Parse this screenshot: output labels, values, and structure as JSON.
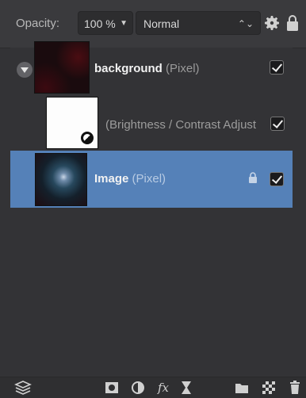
{
  "toolbar": {
    "opacity_label": "Opacity:",
    "opacity_value": "100 %",
    "blend_mode": "Normal"
  },
  "layers": [
    {
      "name": "background",
      "type": "(Pixel)",
      "visible": true,
      "thumbnail": "dark-red-texture"
    },
    {
      "name": "",
      "type": "(Brightness / Contrast Adjust",
      "visible": true,
      "thumbnail": "white-adjustment"
    },
    {
      "name": "Image",
      "type": "(Pixel)",
      "visible": true,
      "locked": true,
      "selected": true,
      "thumbnail": "galaxy"
    }
  ],
  "bottom_icons": [
    "layers-icon",
    "mask-icon",
    "adjustment-icon",
    "fx-icon",
    "live-filter-icon",
    "folder-icon",
    "pixel-layer-icon",
    "trash-icon"
  ],
  "colors": {
    "selected_row": "#5581b8",
    "panel_bg": "#333336"
  }
}
